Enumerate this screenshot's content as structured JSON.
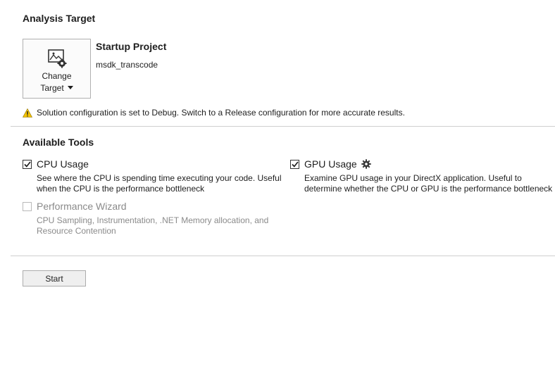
{
  "analysis_target": {
    "title": "Analysis Target",
    "change_target_line1": "Change",
    "change_target_line2": "Target",
    "startup_title": "Startup Project",
    "startup_value": "msdk_transcode",
    "warning": "Solution configuration is set to Debug. Switch to a Release configuration for more accurate results.",
    "warning_color": "#f5c400"
  },
  "available_tools": {
    "title": "Available Tools",
    "tools": [
      {
        "label": "CPU Usage",
        "checked": true,
        "enabled": true,
        "desc_line1": "See where the CPU is spending time executing your code. Useful",
        "desc_line2": "when the CPU is the performance bottleneck"
      },
      {
        "label": "GPU Usage",
        "checked": true,
        "enabled": true,
        "has_settings": true,
        "desc_line1": "Examine GPU usage in your DirectX application. Useful to",
        "desc_line2": "determine whether the CPU or GPU is the performance bottleneck"
      },
      {
        "label": "Performance Wizard",
        "checked": false,
        "enabled": false,
        "desc_line1": "CPU Sampling, Instrumentation, .NET Memory allocation, and",
        "desc_line2": "Resource Contention"
      }
    ]
  },
  "start_button": "Start"
}
